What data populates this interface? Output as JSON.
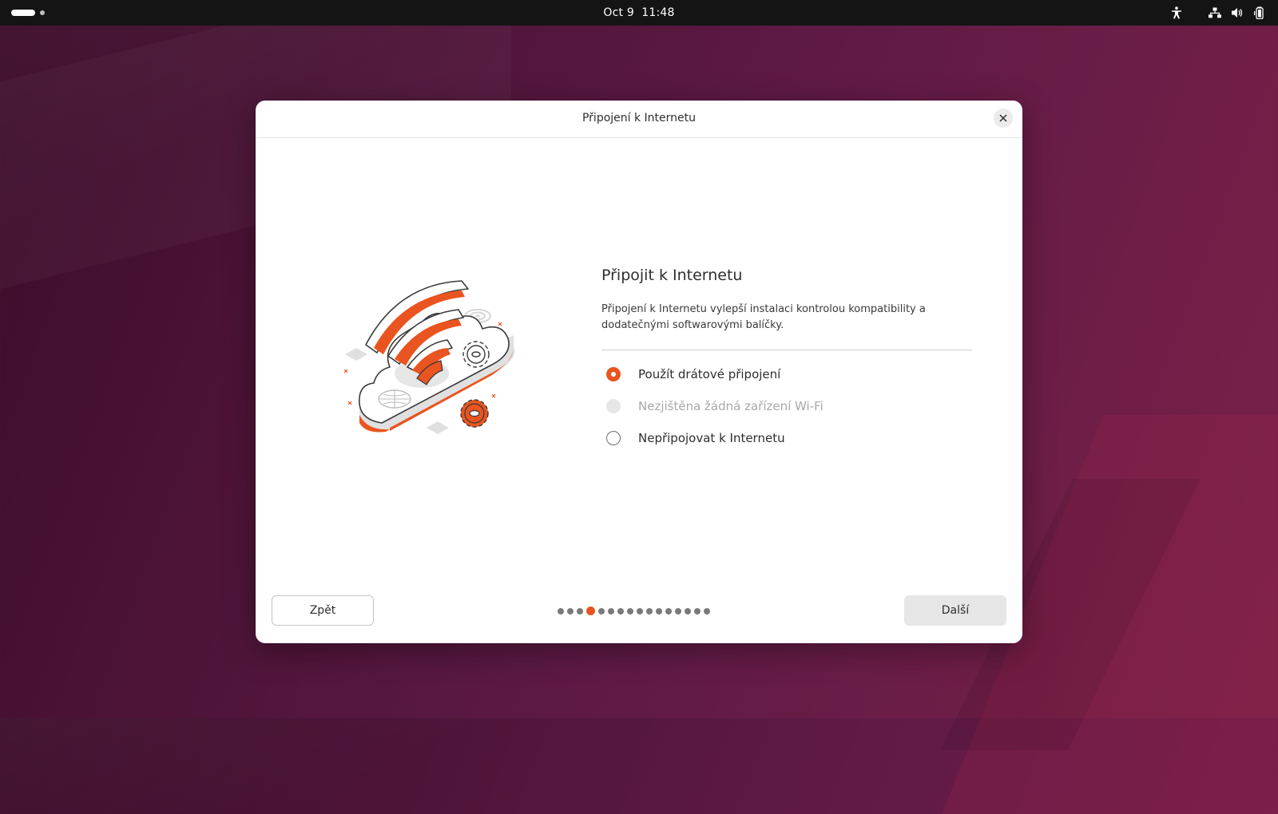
{
  "topbar": {
    "date": "Oct 9",
    "time": "11:48",
    "icons": [
      "accessibility-icon",
      "network-wired-icon",
      "volume-icon",
      "battery-icon"
    ]
  },
  "dialog": {
    "title": "Připojení k Internetu",
    "heading": "Připojit k Internetu",
    "description": "Připojení k Internetu vylepší instalaci kontrolou kompatibility a dodatečnými softwarovými balíčky.",
    "options": [
      {
        "label": "Použít drátové připojení",
        "state": "selected"
      },
      {
        "label": "Nezjištěna žádná zařízení Wi-Fi",
        "state": "disabled"
      },
      {
        "label": "Nepřipojovat k Internetu",
        "state": "unselected"
      }
    ],
    "back_label": "Zpět",
    "next_label": "Další",
    "pager": {
      "total": 16,
      "current": 4
    }
  },
  "colors": {
    "accent": "#e95420",
    "topbar": "#141414",
    "wallpaper": "#5e1a45"
  }
}
